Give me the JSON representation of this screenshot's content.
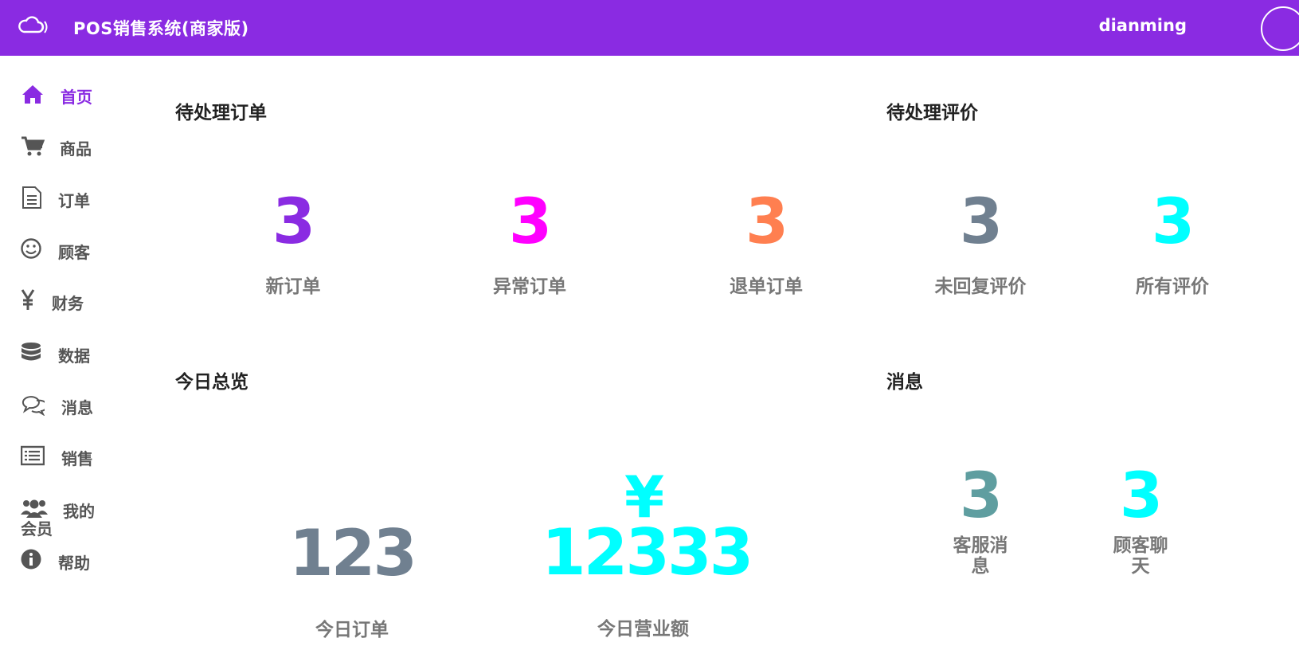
{
  "header": {
    "logo_icon": "cloud-signal-icon",
    "title": "POS销售系统(商家版)",
    "username": "dianming"
  },
  "sidebar": {
    "items": [
      {
        "label": "首页",
        "icon": "home-icon",
        "active": true
      },
      {
        "label": "商品",
        "icon": "cart-icon"
      },
      {
        "label": "订单",
        "icon": "document-icon"
      },
      {
        "label": "顾客",
        "icon": "smile-icon"
      },
      {
        "label": "财务",
        "icon": "yen-icon"
      },
      {
        "label": "数据",
        "icon": "database-icon"
      },
      {
        "label": "消息",
        "icon": "chat-icon"
      },
      {
        "label": "销售",
        "icon": "list-icon"
      },
      {
        "label": "我的",
        "label2": "会员",
        "icon": "users-icon"
      },
      {
        "label": "帮助",
        "icon": "info-icon"
      }
    ]
  },
  "pending_orders": {
    "title": "待处理订单",
    "stats": [
      {
        "value": "3",
        "label": "新订单",
        "color": "#8a2be2"
      },
      {
        "value": "3",
        "label": "异常订单",
        "color": "#ff00ff"
      },
      {
        "value": "3",
        "label": "退单订单",
        "color": "#ff7f50"
      }
    ]
  },
  "pending_reviews": {
    "title": "待处理评价",
    "stats": [
      {
        "value": "3",
        "label": "未回复评价",
        "color": "#708090"
      },
      {
        "value": "3",
        "label": "所有评价",
        "color": "#00ffff"
      }
    ]
  },
  "today": {
    "title": "今日总览",
    "orders": {
      "value": "123",
      "label": "今日订单",
      "color": "#708090"
    },
    "revenue": {
      "currency": "¥",
      "value": "12333",
      "label": "今日营业额",
      "color": "#00ffff"
    }
  },
  "messages": {
    "title": "消息",
    "stats": [
      {
        "value": "3",
        "label": "客服消",
        "label2": "息",
        "color": "#5f9ea0"
      },
      {
        "value": "3",
        "label": "顾客聊",
        "label2": "天",
        "color": "#00ffff"
      }
    ]
  }
}
